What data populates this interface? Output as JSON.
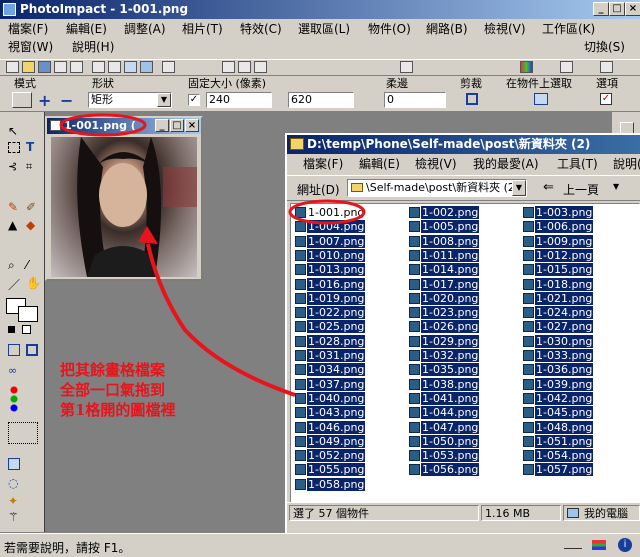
{
  "app": {
    "title": "PhotoImpact - 1-001.png"
  },
  "menu": [
    {
      "label": "檔案(F)"
    },
    {
      "label": "編輯(E)"
    },
    {
      "label": "調整(A)"
    },
    {
      "label": "相片(T)"
    },
    {
      "label": "特效(C)"
    },
    {
      "label": "選取區(L)"
    },
    {
      "label": "物件(O)"
    },
    {
      "label": "網路(B)"
    },
    {
      "label": "檢視(V)"
    },
    {
      "label": "工作區(K)"
    },
    {
      "label": "視窗(W)"
    },
    {
      "label": "說明(H)"
    },
    {
      "label": "切換(S)"
    }
  ],
  "props": {
    "mode_label": "模式",
    "shape_label": "形狀",
    "shape_value": "矩形",
    "fixed_size_label": "固定大小 (像素)",
    "width": "240",
    "height": "620",
    "feather_label": "柔邊",
    "feather_value": "0",
    "crop_label": "剪裁",
    "select_on_object_label": "在物件上選取",
    "options_label": "選項"
  },
  "image_window": {
    "title": "1-001.png ("
  },
  "explorer": {
    "title": "D:\\temp\\Phone\\Self-made\\post\\新資料夾 (2)",
    "menu": [
      "檔案(F)",
      "編輯(E)",
      "檢視(V)",
      "我的最愛(A)",
      "工具(T)",
      "說明(H)"
    ],
    "address_label": "網址(D)",
    "address_value": "\\Self-made\\post\\新資料夾 (2)",
    "back_label": "上一頁",
    "status_count": "選了 57 個物件",
    "status_size": "1.16 MB",
    "status_location": "我的電腦",
    "files": [
      "1-001.png",
      "1-002.png",
      "1-003.png",
      "1-004.png",
      "1-005.png",
      "1-006.png",
      "1-007.png",
      "1-008.png",
      "1-009.png",
      "1-010.png",
      "1-011.png",
      "1-012.png",
      "1-013.png",
      "1-014.png",
      "1-015.png",
      "1-016.png",
      "1-017.png",
      "1-018.png",
      "1-019.png",
      "1-020.png",
      "1-021.png",
      "1-022.png",
      "1-023.png",
      "1-024.png",
      "1-025.png",
      "1-026.png",
      "1-027.png",
      "1-028.png",
      "1-029.png",
      "1-030.png",
      "1-031.png",
      "1-032.png",
      "1-033.png",
      "1-034.png",
      "1-035.png",
      "1-036.png",
      "1-037.png",
      "1-038.png",
      "1-039.png",
      "1-040.png",
      "1-041.png",
      "1-042.png",
      "1-043.png",
      "1-044.png",
      "1-045.png",
      "1-046.png",
      "1-047.png",
      "1-048.png",
      "1-049.png",
      "1-050.png",
      "1-051.png",
      "1-052.png",
      "1-053.png",
      "1-054.png",
      "1-055.png",
      "1-056.png",
      "1-057.png",
      "1-058.png"
    ]
  },
  "annotation": {
    "line1": "把其餘畫格檔案",
    "line2": "全部一口氣拖到",
    "line3": "第1格開的圖檔裡"
  },
  "statusbar": {
    "hint": "若需要說明，請按 F1。"
  },
  "colors": {
    "annotation": "#e8141c",
    "selection": "#0a246a",
    "titlebar": "#0a246a"
  }
}
